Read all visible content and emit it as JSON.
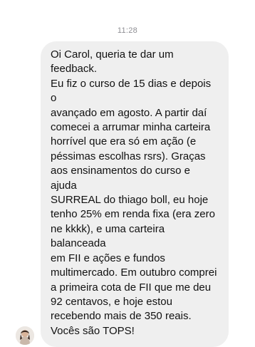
{
  "conversation": {
    "timestamp": "11:28",
    "message": {
      "sender_avatar_icon": "user-avatar-icon",
      "text": "Oi Carol, queria te dar um feedback.\nEu fiz o curso de 15 dias e depois o\navançado em agosto. A partir daí\ncomecei a arrumar minha carteira\nhorrível que era só em ação (e\npéssimas escolhas rsrs). Graças\naos ensinamentos do curso e ajuda\nSURREAL do thiago boll, eu hoje\ntenho 25% em renda fixa (era zero\nne kkkk), e uma carteira balanceada\nem FII e ações e fundos\nmultimercado. Em outubro comprei\na primeira cota de FII que me deu\n92 centavos, e hoje estou\nrecebendo mais de 350 reais.\nVocês são TOPS!",
      "bubble_color": "#efefef"
    }
  }
}
